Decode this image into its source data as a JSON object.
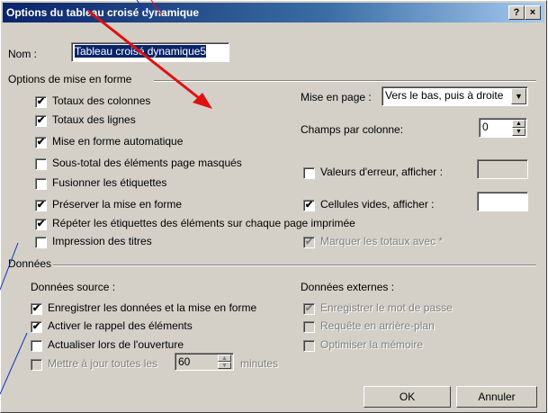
{
  "window": {
    "title": "Options du tableau croisé dynamique",
    "help_label": "?",
    "close_label": "×"
  },
  "name_field": {
    "label": "Nom :",
    "value": "Tableau croisé dynamique5"
  },
  "format_section": {
    "title": "Options de mise en forme",
    "checkboxes": [
      {
        "label": "Totaux des colonnes",
        "checked": true,
        "enabled": true
      },
      {
        "label": "Totaux des lignes",
        "checked": true,
        "enabled": true
      },
      {
        "label": "Mise en forme automatique",
        "checked": true,
        "enabled": true
      },
      {
        "label": "Sous-total des éléments page masqués",
        "checked": false,
        "enabled": true
      },
      {
        "label": "Fusionner les étiquettes",
        "checked": false,
        "enabled": true
      },
      {
        "label": "Préserver la mise en forme",
        "checked": true,
        "enabled": true
      },
      {
        "label": "Répéter les étiquettes des éléments sur chaque page imprimée",
        "checked": true,
        "enabled": true
      },
      {
        "label": "Impression des titres",
        "checked": false,
        "enabled": true
      }
    ],
    "page_layout": {
      "label": "Mise en page :",
      "value": "Vers le bas, puis à droite"
    },
    "fields_per_column": {
      "label": "Champs par colonne:",
      "value": "0"
    },
    "error_values": {
      "label": "Valeurs d'erreur, afficher :",
      "checked": false,
      "value": ""
    },
    "empty_cells": {
      "label": "Cellules vides, afficher :",
      "checked": true,
      "value": ""
    },
    "mark_totals": {
      "label": "Marquer les totaux avec *",
      "checked": true,
      "enabled": false
    }
  },
  "data_section": {
    "title": "Données",
    "source": {
      "title": "Données source :",
      "checkboxes": [
        {
          "label": "Enregistrer les données et la mise en forme",
          "checked": true,
          "enabled": true
        },
        {
          "label": "Activer le rappel des éléments",
          "checked": true,
          "enabled": true
        },
        {
          "label": "Actualiser lors de l'ouverture",
          "checked": false,
          "enabled": true
        }
      ],
      "refresh_every": {
        "label": "Mettre à jour toutes les",
        "value": "60",
        "unit": "minutes",
        "checked": false,
        "enabled": false
      }
    },
    "external": {
      "title": "Données externes :",
      "checkboxes": [
        {
          "label": "Enregistrer le mot de passe",
          "checked": true,
          "enabled": false
        },
        {
          "label": "Requête en arrière-plan",
          "checked": false,
          "enabled": false
        },
        {
          "label": "Optimiser la mémoire",
          "checked": false,
          "enabled": false
        }
      ]
    }
  },
  "buttons": {
    "ok": "OK",
    "cancel": "Annuler"
  },
  "check_mark": "✔",
  "colors": {
    "annotation_red": "#e01010",
    "title_bar": "#0a246a"
  }
}
